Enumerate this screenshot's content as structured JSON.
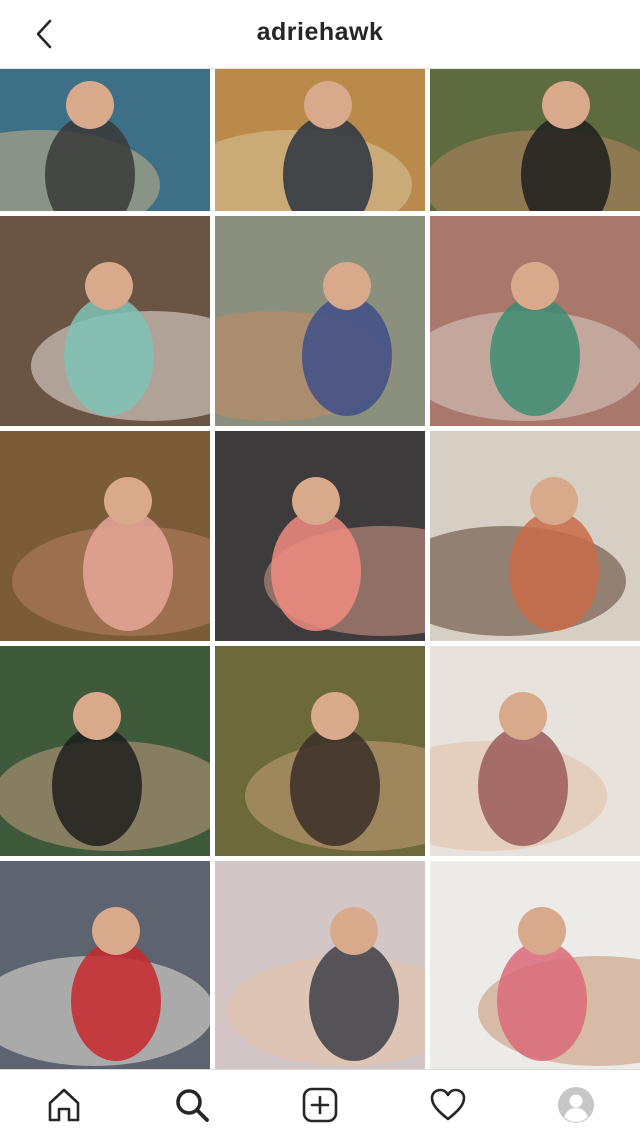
{
  "header": {
    "username": "adriehawk",
    "back_icon": "chevron-left-icon"
  },
  "grid": {
    "posts": [
      {
        "name": "post-dock-lake",
        "bg": "#3d6f86",
        "accent": "#c9b08a",
        "subject": "#3a3a3a"
      },
      {
        "name": "post-autumn-walk",
        "bg": "#b98a4a",
        "accent": "#d9c49a",
        "subject": "#2c3542"
      },
      {
        "name": "post-holding-baby",
        "bg": "#5e6b3f",
        "accent": "#b88563",
        "subject": "#1f1f1f"
      },
      {
        "name": "post-hugging-kids",
        "bg": "#6a5444",
        "accent": "#e9e2dc",
        "subject": "#7fc3b5"
      },
      {
        "name": "post-lounge-chair",
        "bg": "#8a8f7e",
        "accent": "#c48a63",
        "subject": "#3f4f88"
      },
      {
        "name": "post-siblings-bed",
        "bg": "#a9776b",
        "accent": "#d9cfc5",
        "subject": "#3d8c73"
      },
      {
        "name": "post-couch-family",
        "bg": "#7b5b38",
        "accent": "#b88060",
        "subject": "#e7a89a"
      },
      {
        "name": "post-toddler-closeup",
        "bg": "#3d3b3c",
        "accent": "#d69a8a",
        "subject": "#f08c80"
      },
      {
        "name": "post-wine-floor",
        "bg": "#d8cfc4",
        "accent": "#5a3f2f",
        "subject": "#c96b48"
      },
      {
        "name": "post-yoga-daughter",
        "bg": "#3f5a3a",
        "accent": "#c29a80",
        "subject": "#1e1e1e"
      },
      {
        "name": "post-field-sunset",
        "bg": "#6c6a3a",
        "accent": "#c99f78",
        "subject": "#3a2e28"
      },
      {
        "name": "post-newborn-blanket",
        "bg": "#e8e2dc",
        "accent": "#e0c0a8",
        "subject": "#9a5a5a"
      },
      {
        "name": "post-blanket-fort",
        "bg": "#5d6470",
        "accent": "#e9e4dc",
        "subject": "#c8282a"
      },
      {
        "name": "post-babies-pillows",
        "bg": "#d3c6c6",
        "accent": "#e6c2a8",
        "subject": "#3d3f47"
      },
      {
        "name": "post-mirror-selfie",
        "bg": "#ecebe8",
        "accent": "#c99275",
        "subject": "#d96a78"
      }
    ]
  },
  "tabbar": {
    "items": [
      {
        "name": "tab-home",
        "icon": "home-icon"
      },
      {
        "name": "tab-search",
        "icon": "search-icon"
      },
      {
        "name": "tab-new-post",
        "icon": "add-post-icon"
      },
      {
        "name": "tab-activity",
        "icon": "heart-icon"
      },
      {
        "name": "tab-profile",
        "icon": "avatar-icon"
      }
    ]
  },
  "colors": {
    "text": "#262626",
    "divider": "#dbdbdb",
    "avatar": "#c7c7c7"
  }
}
